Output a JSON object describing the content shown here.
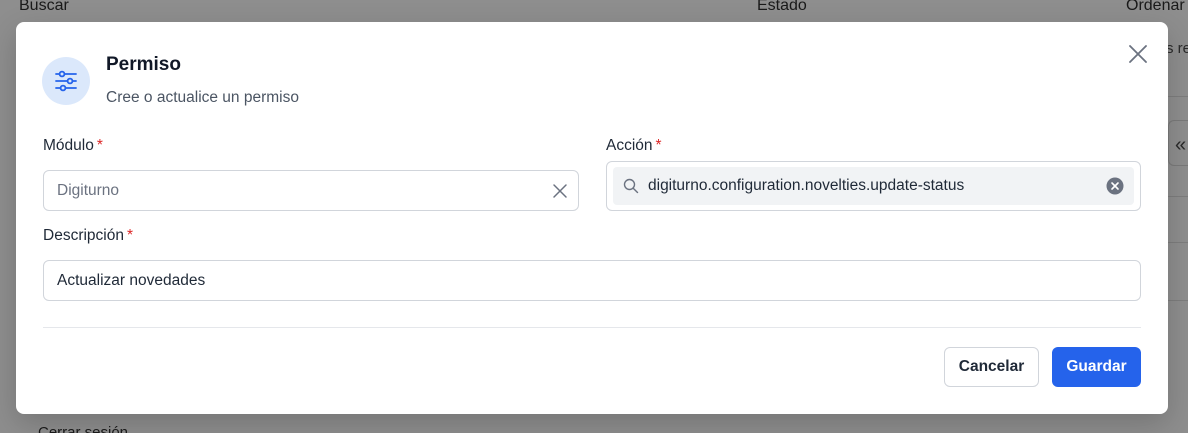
{
  "background": {
    "col_buscar": "Buscar",
    "col_estado": "Estado",
    "col_ordenar": "Ordenar",
    "cell_text": "s re",
    "footer_text": "Cerrar sesión"
  },
  "modal": {
    "title": "Permiso",
    "subtitle": "Cree o actualice un permiso",
    "required_mark": "*",
    "fields": {
      "modulo": {
        "label": "Módulo",
        "placeholder": "Digiturno"
      },
      "accion": {
        "label": "Acción",
        "value": "digiturno.configuration.novelties.update-status"
      },
      "descripcion": {
        "label": "Descripción",
        "value": "Actualizar novedades"
      }
    },
    "buttons": {
      "cancel": "Cancelar",
      "save": "Guardar"
    },
    "icons": {
      "header": "sliders-icon",
      "close": "close-icon",
      "clear": "clear-icon",
      "search": "search-icon"
    },
    "colors": {
      "primary": "#2563eb",
      "required": "#dc2626",
      "icon_bg": "#dbe8fb"
    }
  }
}
